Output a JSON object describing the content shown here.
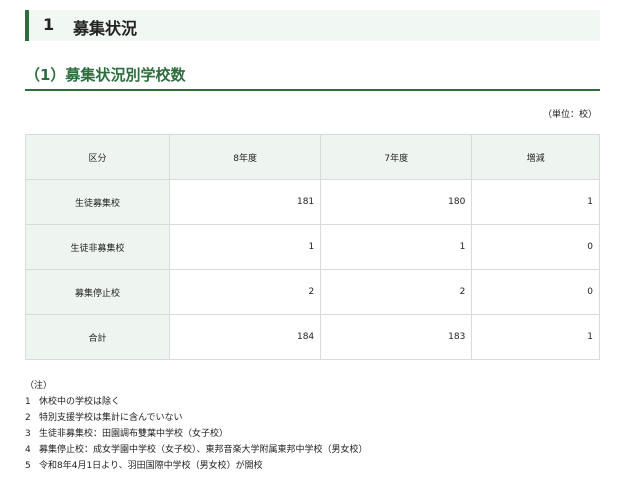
{
  "heading1": {
    "num": "1",
    "title": "募集状況"
  },
  "heading2": "（1）募集状況別学校数",
  "unit": "（単位：校）",
  "table": {
    "headers": [
      "区分",
      "8年度",
      "7年度",
      "増減"
    ],
    "rows": [
      [
        "生徒募集校",
        "181",
        "180",
        "1"
      ],
      [
        "生徒非募集校",
        "1",
        "1",
        "0"
      ],
      [
        "募集停止校",
        "2",
        "2",
        "0"
      ],
      [
        "合計",
        "184",
        "183",
        "1"
      ]
    ]
  },
  "notes": {
    "title": "（注）",
    "items": [
      {
        "n": "1",
        "text": "休校中の学校は除く"
      },
      {
        "n": "2",
        "text": "特別支援学校は集計に含んでいない"
      },
      {
        "n": "3",
        "text": "生徒非募集校：田園調布雙葉中学校（女子校）"
      },
      {
        "n": "4",
        "text": "募集停止校：成女学園中学校（女子校）、東邦音楽大学附属東邦中学校（男女校）"
      },
      {
        "n": "5",
        "text": "令和8年4月1日より、羽田国際中学校（男女校）が開校"
      }
    ]
  }
}
